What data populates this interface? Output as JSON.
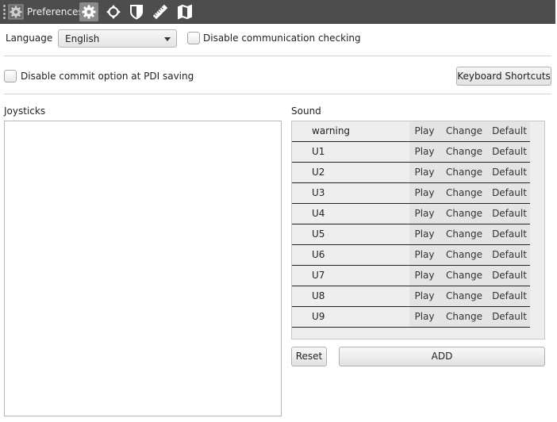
{
  "toolbar": {
    "title": "Preferences",
    "icons": [
      "preferences-gear-icon",
      "settings-gear-icon",
      "move-arrows-icon",
      "shield-icon",
      "ruler-icon",
      "map-icon"
    ],
    "active_icon": "settings-gear-icon",
    "background": "#4d4d4d"
  },
  "language": {
    "label": "Language",
    "selected": "English"
  },
  "disable_comm_check": {
    "label": "Disable communication checking",
    "checked": false
  },
  "disable_commit": {
    "label": "Disable commit option at PDI saving",
    "checked": false
  },
  "keyboard_shortcuts_label": "Keyboard Shortcuts",
  "joysticks": {
    "title": "Joysticks",
    "items": []
  },
  "sound": {
    "title": "Sound",
    "rows": [
      {
        "name": "warning",
        "play": "Play",
        "change": "Change",
        "default": "Default"
      },
      {
        "name": "U1",
        "play": "Play",
        "change": "Change",
        "default": "Default"
      },
      {
        "name": "U2",
        "play": "Play",
        "change": "Change",
        "default": "Default"
      },
      {
        "name": "U3",
        "play": "Play",
        "change": "Change",
        "default": "Default"
      },
      {
        "name": "U4",
        "play": "Play",
        "change": "Change",
        "default": "Default"
      },
      {
        "name": "U5",
        "play": "Play",
        "change": "Change",
        "default": "Default"
      },
      {
        "name": "U6",
        "play": "Play",
        "change": "Change",
        "default": "Default"
      },
      {
        "name": "U7",
        "play": "Play",
        "change": "Change",
        "default": "Default"
      },
      {
        "name": "U8",
        "play": "Play",
        "change": "Change",
        "default": "Default"
      },
      {
        "name": "U9",
        "play": "Play",
        "change": "Change",
        "default": "Default"
      }
    ],
    "reset_label": "Reset",
    "add_label": "ADD"
  }
}
